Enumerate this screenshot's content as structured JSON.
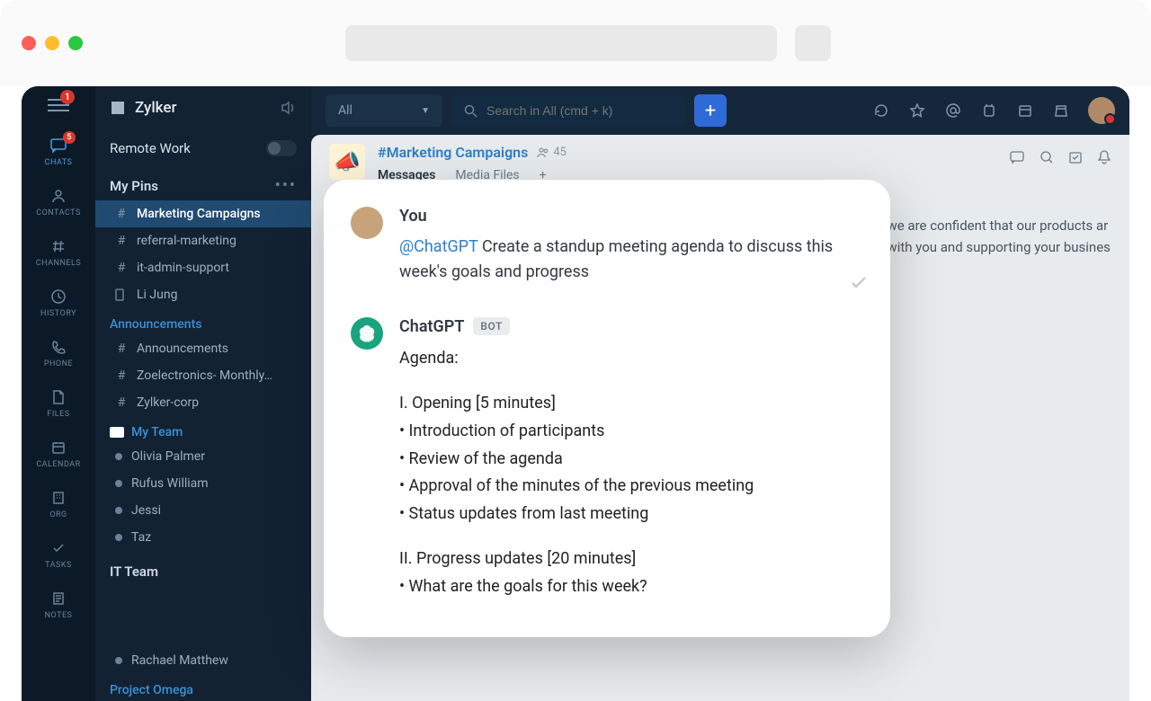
{
  "browser": {
    "notification_count": "1"
  },
  "brand": {
    "name": "Zylker"
  },
  "workspace": {
    "name": "Remote Work"
  },
  "rail": {
    "chats": {
      "label": "CHATS",
      "badge": "5"
    },
    "contacts": {
      "label": "CONTACTS"
    },
    "channels": {
      "label": "CHANNELS"
    },
    "history": {
      "label": "HISTORY"
    },
    "phone": {
      "label": "PHONE"
    },
    "files": {
      "label": "FILES"
    },
    "calendar": {
      "label": "CALENDAR"
    },
    "org": {
      "label": "ORG"
    },
    "tasks": {
      "label": "TASKS"
    },
    "notes": {
      "label": "NOTES"
    }
  },
  "sidebar": {
    "pins": {
      "title": "My Pins",
      "items": [
        {
          "label": "Marketing Campaigns",
          "type": "hash",
          "active": true
        },
        {
          "label": "referral-marketing",
          "type": "hash"
        },
        {
          "label": "it-admin-support",
          "type": "hash"
        },
        {
          "label": "Li Jung",
          "type": "phone"
        }
      ]
    },
    "announcements": {
      "title": "Announcements",
      "items": [
        {
          "label": "Announcements"
        },
        {
          "label": "Zoelectronics- Monthly…"
        },
        {
          "label": "Zylker-corp"
        }
      ]
    },
    "myteam": {
      "title": "My Team",
      "items": [
        {
          "label": "Olivia Palmer"
        },
        {
          "label": "Rufus William"
        },
        {
          "label": "Jessi"
        },
        {
          "label": "Taz"
        }
      ]
    },
    "itteam": {
      "title": "IT Team",
      "items": [
        {
          "label": "Rachael Matthew"
        }
      ]
    },
    "project_omega": {
      "title": "Project Omega"
    }
  },
  "topbar": {
    "filter": "All",
    "search_placeholder": "Search in All (cmd + k)"
  },
  "channel": {
    "name": "#Marketing Campaigns",
    "members": "45",
    "tabs": {
      "messages": "Messages",
      "media": "Media Files"
    },
    "bg_line1": "nd we are confident that our products ar",
    "bg_line2": "ng with you and supporting your busines"
  },
  "card": {
    "you": {
      "author": "You",
      "mention": "@ChatGPT",
      "text": "  Create a standup meeting agenda to discuss this week's goals and progress"
    },
    "bot": {
      "author": "ChatGPT",
      "pill": "BOT",
      "agenda_label": "Agenda:",
      "s1_title": "I. Opening [5 minutes]",
      "s1_b1": "• Introduction of participants",
      "s1_b2": "• Review of the agenda",
      "s1_b3": "• Approval of the minutes of the previous meeting",
      "s1_b4": "• Status updates from last meeting",
      "s2_title": "II. Progress updates [20 minutes]",
      "s2_b1": "• What are the goals for this week?"
    }
  }
}
